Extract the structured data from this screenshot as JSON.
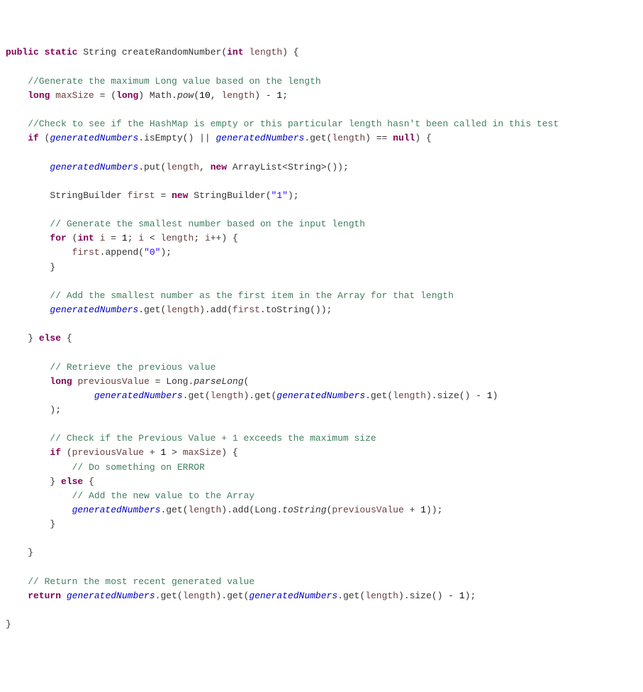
{
  "code": {
    "tokens": [
      [
        {
          "c": "kw",
          "t": "public"
        },
        {
          "c": "op",
          "t": " "
        },
        {
          "c": "kw",
          "t": "static"
        },
        {
          "c": "op",
          "t": " "
        },
        {
          "c": "ty",
          "t": "String"
        },
        {
          "c": "op",
          "t": " "
        },
        {
          "c": "fn",
          "t": "createRandomNumber"
        },
        {
          "c": "op",
          "t": "("
        },
        {
          "c": "kw",
          "t": "int"
        },
        {
          "c": "op",
          "t": " "
        },
        {
          "c": "id",
          "t": "length"
        },
        {
          "c": "op",
          "t": ") {"
        }
      ],
      [],
      [
        {
          "c": "op",
          "t": "    "
        },
        {
          "c": "cm",
          "t": "//Generate the maximum Long value based on the length"
        }
      ],
      [
        {
          "c": "op",
          "t": "    "
        },
        {
          "c": "kw",
          "t": "long"
        },
        {
          "c": "op",
          "t": " "
        },
        {
          "c": "id",
          "t": "maxSize"
        },
        {
          "c": "op",
          "t": " = ("
        },
        {
          "c": "kw",
          "t": "long"
        },
        {
          "c": "op",
          "t": ") "
        },
        {
          "c": "ty",
          "t": "Math"
        },
        {
          "c": "op",
          "t": "."
        },
        {
          "c": "smi",
          "t": "pow"
        },
        {
          "c": "op",
          "t": "("
        },
        {
          "c": "num",
          "t": "10"
        },
        {
          "c": "op",
          "t": ", "
        },
        {
          "c": "id",
          "t": "length"
        },
        {
          "c": "op",
          "t": ") - "
        },
        {
          "c": "num",
          "t": "1"
        },
        {
          "c": "op",
          "t": ";"
        }
      ],
      [],
      [
        {
          "c": "op",
          "t": "    "
        },
        {
          "c": "cm",
          "t": "//Check to see if the HashMap is empty or this particular length hasn't been called in this test"
        }
      ],
      [
        {
          "c": "op",
          "t": "    "
        },
        {
          "c": "kw",
          "t": "if"
        },
        {
          "c": "op",
          "t": " ("
        },
        {
          "c": "fldi",
          "t": "generatedNumbers"
        },
        {
          "c": "op",
          "t": ".isEmpty() || "
        },
        {
          "c": "fldi",
          "t": "generatedNumbers"
        },
        {
          "c": "op",
          "t": ".get("
        },
        {
          "c": "id",
          "t": "length"
        },
        {
          "c": "op",
          "t": ") == "
        },
        {
          "c": "kw",
          "t": "null"
        },
        {
          "c": "op",
          "t": ") {"
        }
      ],
      [],
      [
        {
          "c": "op",
          "t": "        "
        },
        {
          "c": "fldi",
          "t": "generatedNumbers"
        },
        {
          "c": "op",
          "t": ".put("
        },
        {
          "c": "id",
          "t": "length"
        },
        {
          "c": "op",
          "t": ", "
        },
        {
          "c": "kw",
          "t": "new"
        },
        {
          "c": "op",
          "t": " "
        },
        {
          "c": "ty",
          "t": "ArrayList"
        },
        {
          "c": "op",
          "t": "<"
        },
        {
          "c": "ty",
          "t": "String"
        },
        {
          "c": "op",
          "t": ">());"
        }
      ],
      [],
      [
        {
          "c": "op",
          "t": "        "
        },
        {
          "c": "ty",
          "t": "StringBuilder"
        },
        {
          "c": "op",
          "t": " "
        },
        {
          "c": "id",
          "t": "first"
        },
        {
          "c": "op",
          "t": " = "
        },
        {
          "c": "kw",
          "t": "new"
        },
        {
          "c": "op",
          "t": " "
        },
        {
          "c": "ty",
          "t": "StringBuilder"
        },
        {
          "c": "op",
          "t": "("
        },
        {
          "c": "str",
          "t": "\"1\""
        },
        {
          "c": "op",
          "t": ");"
        }
      ],
      [],
      [
        {
          "c": "op",
          "t": "        "
        },
        {
          "c": "cm",
          "t": "// Generate the smallest number based on the input length"
        }
      ],
      [
        {
          "c": "op",
          "t": "        "
        },
        {
          "c": "kw",
          "t": "for"
        },
        {
          "c": "op",
          "t": " ("
        },
        {
          "c": "kw",
          "t": "int"
        },
        {
          "c": "op",
          "t": " "
        },
        {
          "c": "id",
          "t": "i"
        },
        {
          "c": "op",
          "t": " = "
        },
        {
          "c": "num",
          "t": "1"
        },
        {
          "c": "op",
          "t": "; "
        },
        {
          "c": "id",
          "t": "i"
        },
        {
          "c": "op",
          "t": " < "
        },
        {
          "c": "id",
          "t": "length"
        },
        {
          "c": "op",
          "t": "; "
        },
        {
          "c": "id",
          "t": "i"
        },
        {
          "c": "op",
          "t": "++) {"
        }
      ],
      [
        {
          "c": "op",
          "t": "            "
        },
        {
          "c": "id",
          "t": "first"
        },
        {
          "c": "op",
          "t": ".append("
        },
        {
          "c": "str",
          "t": "\"0\""
        },
        {
          "c": "op",
          "t": ");"
        }
      ],
      [
        {
          "c": "op",
          "t": "        }"
        }
      ],
      [],
      [
        {
          "c": "op",
          "t": "        "
        },
        {
          "c": "cm",
          "t": "// Add the smallest number as the first item in the Array for that length"
        }
      ],
      [
        {
          "c": "op",
          "t": "        "
        },
        {
          "c": "fldi",
          "t": "generatedNumbers"
        },
        {
          "c": "op",
          "t": ".get("
        },
        {
          "c": "id",
          "t": "length"
        },
        {
          "c": "op",
          "t": ").add("
        },
        {
          "c": "id",
          "t": "first"
        },
        {
          "c": "op",
          "t": ".toString());"
        }
      ],
      [],
      [
        {
          "c": "op",
          "t": "    } "
        },
        {
          "c": "kw",
          "t": "else"
        },
        {
          "c": "op",
          "t": " {"
        }
      ],
      [],
      [
        {
          "c": "op",
          "t": "        "
        },
        {
          "c": "cm",
          "t": "// Retrieve the previous value"
        }
      ],
      [
        {
          "c": "op",
          "t": "        "
        },
        {
          "c": "kw",
          "t": "long"
        },
        {
          "c": "op",
          "t": " "
        },
        {
          "c": "id",
          "t": "previousValue"
        },
        {
          "c": "op",
          "t": " = "
        },
        {
          "c": "ty",
          "t": "Long"
        },
        {
          "c": "op",
          "t": "."
        },
        {
          "c": "smi",
          "t": "parseLong"
        },
        {
          "c": "op",
          "t": "("
        }
      ],
      [
        {
          "c": "op",
          "t": "                "
        },
        {
          "c": "fldi",
          "t": "generatedNumbers"
        },
        {
          "c": "op",
          "t": ".get("
        },
        {
          "c": "id",
          "t": "length"
        },
        {
          "c": "op",
          "t": ").get("
        },
        {
          "c": "fldi",
          "t": "generatedNumbers"
        },
        {
          "c": "op",
          "t": ".get("
        },
        {
          "c": "id",
          "t": "length"
        },
        {
          "c": "op",
          "t": ").size() - "
        },
        {
          "c": "num",
          "t": "1"
        },
        {
          "c": "op",
          "t": ")"
        }
      ],
      [
        {
          "c": "op",
          "t": "        );"
        }
      ],
      [],
      [
        {
          "c": "op",
          "t": "        "
        },
        {
          "c": "cm",
          "t": "// Check if the Previous Value + 1 exceeds the maximum size"
        }
      ],
      [
        {
          "c": "op",
          "t": "        "
        },
        {
          "c": "kw",
          "t": "if"
        },
        {
          "c": "op",
          "t": " ("
        },
        {
          "c": "id",
          "t": "previousValue"
        },
        {
          "c": "op",
          "t": " + "
        },
        {
          "c": "num",
          "t": "1"
        },
        {
          "c": "op",
          "t": " > "
        },
        {
          "c": "id",
          "t": "maxSize"
        },
        {
          "c": "op",
          "t": ") {"
        }
      ],
      [
        {
          "c": "op",
          "t": "            "
        },
        {
          "c": "cm",
          "t": "// Do something on ERROR"
        }
      ],
      [
        {
          "c": "op",
          "t": "        } "
        },
        {
          "c": "kw",
          "t": "else"
        },
        {
          "c": "op",
          "t": " {"
        }
      ],
      [
        {
          "c": "op",
          "t": "            "
        },
        {
          "c": "cm",
          "t": "// Add the new value to the Array"
        }
      ],
      [
        {
          "c": "op",
          "t": "            "
        },
        {
          "c": "fldi",
          "t": "generatedNumbers"
        },
        {
          "c": "op",
          "t": ".get("
        },
        {
          "c": "id",
          "t": "length"
        },
        {
          "c": "op",
          "t": ").add("
        },
        {
          "c": "ty",
          "t": "Long"
        },
        {
          "c": "op",
          "t": "."
        },
        {
          "c": "smi",
          "t": "toString"
        },
        {
          "c": "op",
          "t": "("
        },
        {
          "c": "id",
          "t": "previousValue"
        },
        {
          "c": "op",
          "t": " + "
        },
        {
          "c": "num",
          "t": "1"
        },
        {
          "c": "op",
          "t": "));"
        }
      ],
      [
        {
          "c": "op",
          "t": "        }"
        }
      ],
      [],
      [
        {
          "c": "op",
          "t": "    }"
        }
      ],
      [],
      [
        {
          "c": "op",
          "t": "    "
        },
        {
          "c": "cm",
          "t": "// Return the most recent generated value"
        }
      ],
      [
        {
          "c": "op",
          "t": "    "
        },
        {
          "c": "kw",
          "t": "return"
        },
        {
          "c": "op",
          "t": " "
        },
        {
          "c": "fldi",
          "t": "generatedNumbers"
        },
        {
          "c": "op",
          "t": ".get("
        },
        {
          "c": "id",
          "t": "length"
        },
        {
          "c": "op",
          "t": ").get("
        },
        {
          "c": "fldi",
          "t": "generatedNumbers"
        },
        {
          "c": "op",
          "t": ".get("
        },
        {
          "c": "id",
          "t": "length"
        },
        {
          "c": "op",
          "t": ").size() - "
        },
        {
          "c": "num",
          "t": "1"
        },
        {
          "c": "op",
          "t": ");"
        }
      ],
      [],
      [
        {
          "c": "op",
          "t": "}"
        }
      ]
    ]
  }
}
